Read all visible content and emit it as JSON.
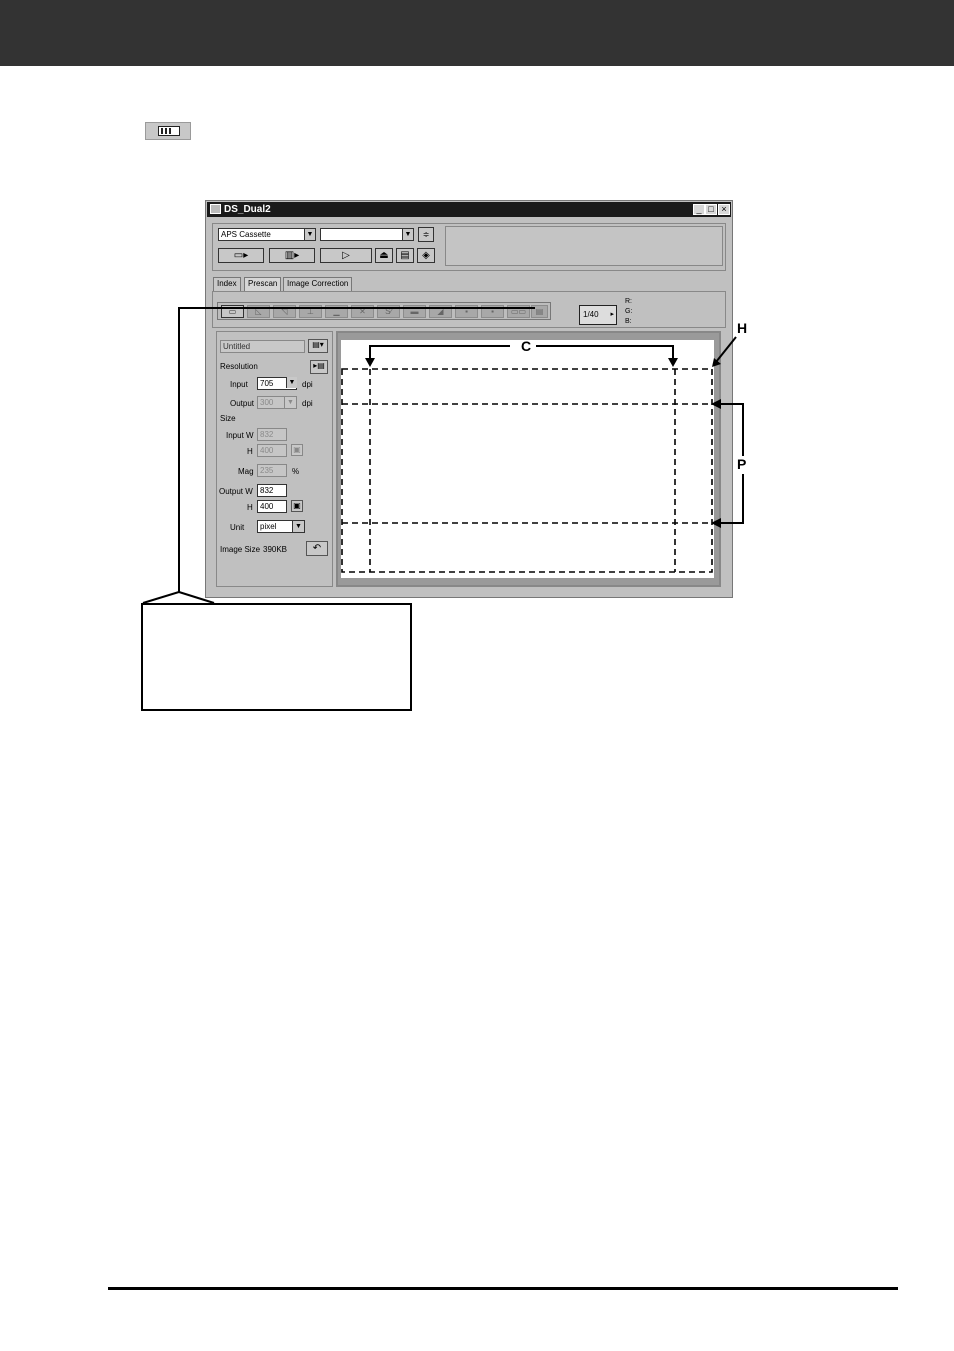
{
  "window": {
    "title": "DS_Dual2",
    "min_label": "_",
    "max_label": "□",
    "close_label": "×"
  },
  "top_panel": {
    "film_type": "APS Cassette",
    "second_select": "",
    "buttons": [
      "index-scan",
      "prescan",
      "scan",
      "eject",
      "preferences",
      "help"
    ]
  },
  "tabs": [
    "Index",
    "Prescan",
    "Image Correction"
  ],
  "frame_counter": "1/40",
  "rgb": {
    "r": "R:",
    "g": "G:",
    "b": "B:"
  },
  "settings": {
    "setting_name": "Untitled",
    "resolution_label": "Resolution",
    "input_label": "Input",
    "input_value": "705",
    "dpi_label": "dpi",
    "output_label": "Output",
    "output_value": "300",
    "size_label": "Size",
    "input_w_label": "Input W",
    "input_w_value": "832",
    "h_label": "H",
    "input_h_value": "400",
    "mag_label": "Mag",
    "mag_value": "235",
    "percent_label": "%",
    "output_w_label": "Output W",
    "output_w_value": "832",
    "output_h_value": "400",
    "unit_label": "Unit",
    "unit_value": "pixel",
    "image_size_label": "Image Size",
    "image_size_value": "390KB"
  },
  "callouts": {
    "c": "C",
    "h": "H",
    "p": "P"
  }
}
